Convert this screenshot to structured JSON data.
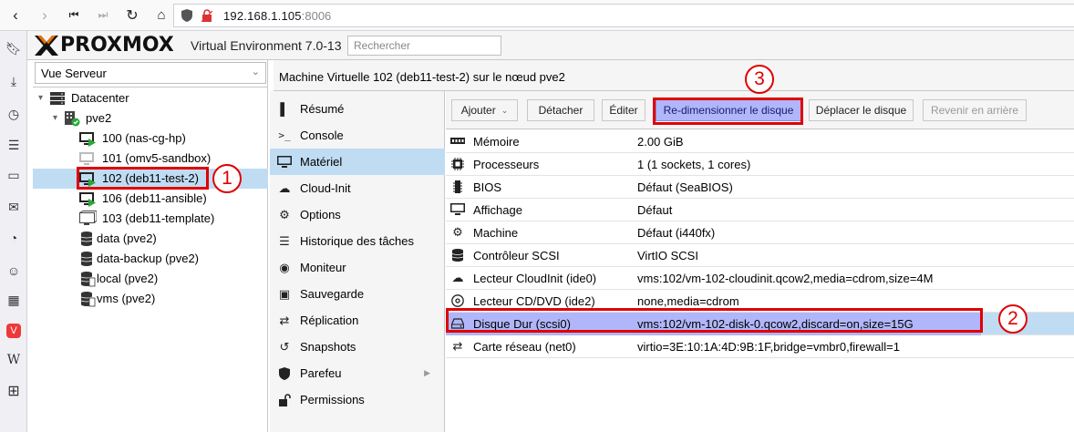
{
  "browser": {
    "url_host": "192.168.1.105",
    "url_port": ":8006"
  },
  "header": {
    "logo_text": "PROXMOX",
    "product": "Virtual Environment 7.0-13",
    "search_placeholder": "Rechercher"
  },
  "tree": {
    "view": "Vue Serveur",
    "datacenter": "Datacenter",
    "node": "pve2",
    "items": [
      {
        "label": "100 (nas-cg-hp)",
        "type": "vm-running"
      },
      {
        "label": "101 (omv5-sandbox)",
        "type": "vm-stopped"
      },
      {
        "label": "102 (deb11-test-2)",
        "type": "vm-running"
      },
      {
        "label": "106 (deb11-ansible)",
        "type": "vm-running"
      },
      {
        "label": "103 (deb11-template)",
        "type": "template"
      },
      {
        "label": "data (pve2)",
        "type": "storage"
      },
      {
        "label": "data-backup (pve2)",
        "type": "storage"
      },
      {
        "label": "local (pve2)",
        "type": "storage"
      },
      {
        "label": "vms (pve2)",
        "type": "storage"
      }
    ]
  },
  "content": {
    "title": "Machine Virtuelle 102 (deb11-test-2) sur le nœud pve2"
  },
  "vm_nav": [
    {
      "label": "Résumé",
      "icon": "summary-icon"
    },
    {
      "label": "Console",
      "icon": "terminal-icon"
    },
    {
      "label": "Matériel",
      "icon": "monitor-icon"
    },
    {
      "label": "Cloud-Init",
      "icon": "cloud-icon"
    },
    {
      "label": "Options",
      "icon": "gear-icon"
    },
    {
      "label": "Historique des tâches",
      "icon": "list-icon"
    },
    {
      "label": "Moniteur",
      "icon": "eye-icon"
    },
    {
      "label": "Sauvegarde",
      "icon": "save-icon"
    },
    {
      "label": "Réplication",
      "icon": "retweet-icon"
    },
    {
      "label": "Snapshots",
      "icon": "history-icon"
    },
    {
      "label": "Parefeu",
      "icon": "shield-icon"
    },
    {
      "label": "Permissions",
      "icon": "unlock-icon"
    }
  ],
  "toolbar": {
    "add": "Ajouter",
    "detach": "Détacher",
    "edit": "Éditer",
    "resize": "Re-dimensionner le disque",
    "move": "Déplacer le disque",
    "revert": "Revenir en arrière"
  },
  "hardware": [
    {
      "name": "Mémoire",
      "value": "2.00 GiB",
      "icon": "memory-icon"
    },
    {
      "name": "Processeurs",
      "value": "1 (1 sockets, 1 cores)",
      "icon": "cpu-icon"
    },
    {
      "name": "BIOS",
      "value": "Défaut (SeaBIOS)",
      "icon": "microchip-icon"
    },
    {
      "name": "Affichage",
      "value": "Défaut",
      "icon": "desktop-icon"
    },
    {
      "name": "Machine",
      "value": "Défaut (i440fx)",
      "icon": "cogs-icon"
    },
    {
      "name": "Contrôleur SCSI",
      "value": "VirtIO SCSI",
      "icon": "database-icon"
    },
    {
      "name": "Lecteur CloudInit (ide0)",
      "value": "vms:102/vm-102-cloudinit.qcow2,media=cdrom,size=4M",
      "icon": "cloud-icon"
    },
    {
      "name": "Lecteur CD/DVD (ide2)",
      "value": "none,media=cdrom",
      "icon": "cdrom-icon"
    },
    {
      "name": "Disque Dur (scsi0)",
      "value": "vms:102/vm-102-disk-0.qcow2,discard=on,size=15G",
      "icon": "hdd-icon"
    },
    {
      "name": "Carte réseau (net0)",
      "value": "virtio=3E:10:1A:4D:9B:1F,bridge=vmbr0,firewall=1",
      "icon": "exchange-icon"
    }
  ],
  "annotations": [
    "1",
    "2",
    "3"
  ]
}
